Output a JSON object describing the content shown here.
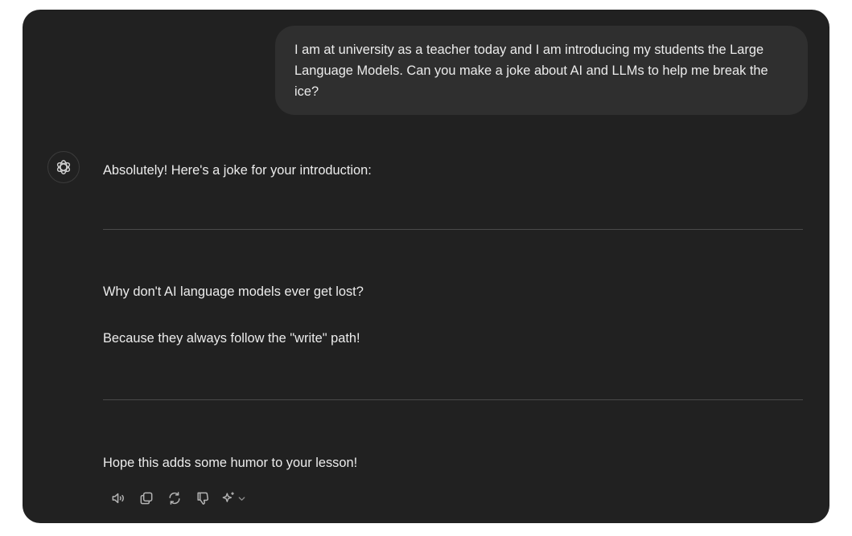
{
  "conversation": {
    "user_message": "I am at university as a teacher today and I am introducing my students the Large Language Models. Can you make a joke about AI and LLMs to help me break the ice?",
    "assistant": {
      "avatar_icon": "openai-logo-icon",
      "intro": "Absolutely! Here's a joke for your introduction:",
      "joke_question": "Why don't AI language models ever get lost?",
      "joke_answer": "Because they always follow the \"write\" path!",
      "closing": "Hope this adds some humor to your lesson!"
    }
  },
  "action_bar": {
    "icons": [
      "read-aloud-icon",
      "copy-icon",
      "regenerate-icon",
      "thumbs-down-icon",
      "sparkle-icon",
      "chevron-down-icon"
    ]
  },
  "colors": {
    "background": "#212121",
    "bubble": "#2f2f2f",
    "text": "#ececec",
    "icon": "#b4b4b4",
    "divider": "#4a4a4a"
  }
}
